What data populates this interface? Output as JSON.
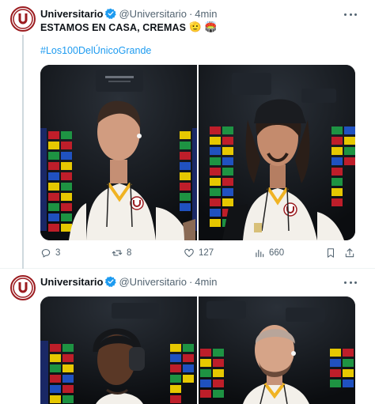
{
  "tweets": [
    {
      "author": {
        "name": "Universitario",
        "handle": "@Universitario",
        "dot": "·",
        "time": "4min"
      },
      "text": "ESTAMOS EN CASA, CREMAS",
      "emoji": [
        "🫡",
        "🏟️"
      ],
      "hashtag": "#Los100DelÚnicoGrande",
      "media_count": 2,
      "stats": {
        "replies": "3",
        "reposts": "8",
        "likes": "127",
        "views": "660"
      }
    },
    {
      "author": {
        "name": "Universitario",
        "handle": "@Universitario",
        "dot": "·",
        "time": "4min"
      },
      "media_count": 2
    }
  ],
  "icons": {
    "avatar": "universitario-crest",
    "verified": "verified-badge",
    "more": "more-dots",
    "reply": "reply-icon",
    "repost": "repost-icon",
    "like": "heart-icon",
    "views": "views-icon",
    "bookmark": "bookmark-icon",
    "share": "share-icon"
  },
  "colors": {
    "accent": "#1d9bf0",
    "brand_red": "#9b1b1f",
    "muted": "#536471",
    "jersey_cream": "#f3f0ea"
  }
}
